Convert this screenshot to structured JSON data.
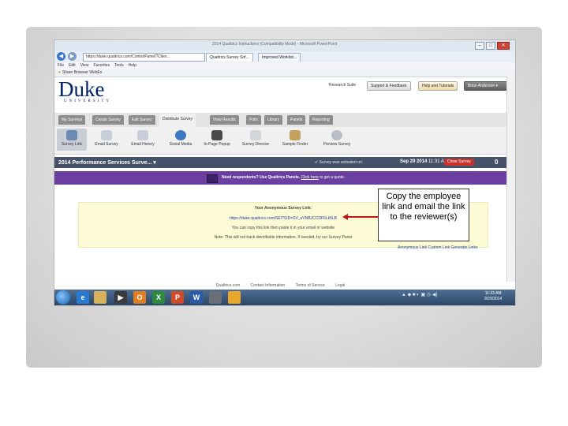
{
  "window": {
    "title": "2014 Qualtrics Instructions (Compatibility Mode) - Microsoft PowerPoint",
    "controls": [
      "–",
      "□",
      "✕"
    ]
  },
  "browser": {
    "address": "https://duke.qualtrics.com/ControlPanel/?Clien...",
    "tabs": [
      "Qualtrics Survey Sof...",
      "Improved Worklist..."
    ],
    "menu": [
      "File",
      "Edit",
      "View",
      "Favorites",
      "Tools",
      "Help"
    ],
    "favorites": "Share Browser  WebEx"
  },
  "header": {
    "logo": "Duke",
    "logo_sub": "UNIVERSITY",
    "research_suite": "Research Suite",
    "support_button": "Support & Feedback",
    "help_button": "Help and Tutorials",
    "user_button": "Brian Anderson"
  },
  "main_tabs": [
    {
      "label": "My Surveys",
      "active": false
    },
    {
      "label": "Create Survey",
      "active": false
    },
    {
      "label": "Edit Survey",
      "active": false
    },
    {
      "label": "Distribute Survey",
      "active": true
    },
    {
      "label": "View Results",
      "active": false
    },
    {
      "label": "Polls",
      "active": false
    },
    {
      "label": "Library",
      "active": false
    },
    {
      "label": "Panels",
      "active": false
    },
    {
      "label": "Reporting",
      "active": false
    }
  ],
  "sub_tabs": [
    {
      "label": "Survey Link",
      "active": true,
      "color": "#6b8bb5"
    },
    {
      "label": "Email Survey",
      "active": false,
      "color": "#c9cfd8"
    },
    {
      "label": "Email History",
      "active": false,
      "color": "#c9cfd8"
    },
    {
      "label": "Social Media",
      "active": false,
      "color": "#3d78c2"
    },
    {
      "label": "In-Page Popup",
      "active": false,
      "color": "#4a4a4a"
    },
    {
      "label": "Survey Director",
      "active": false,
      "color": "#d2d6dc"
    },
    {
      "label": "Sample Finder",
      "active": false,
      "color": "#c4a15c"
    },
    {
      "label": "Preview Survey",
      "active": false,
      "color": "#b9bec6"
    }
  ],
  "survey_bar": {
    "title": "2014 Performance Services Surve...",
    "status": "Survey was activated on:",
    "date": "Sep 29 2014",
    "time": "11:31 AM",
    "close_button": "Close Survey",
    "count": "0"
  },
  "promo": {
    "text": "Need respondents? Use Qualtrics Panels.",
    "link": "Click here",
    "suffix": "to get a quote."
  },
  "link_box": {
    "heading": "Your Anonymous Survey Link:",
    "url": "https://duke.qualtrics.com/SE/?SID=SV_eVNBJCCDF6Lk5LB",
    "copy_note": "You can copy this link then paste it in your email or website",
    "note": "Note: This will not track identifiable information. If needed, try our Survey Panel",
    "extra_links": "Anonymous Link   Custom Link   Generate Links"
  },
  "footer": [
    "Qualtrics.com",
    "Contact Information",
    "Terms of Service",
    "Legal"
  ],
  "taskbar": {
    "clock_time": "11:33 AM",
    "clock_date": "9/29/2014"
  },
  "callout": {
    "text": "Copy the employee link and email the link to the reviewer(s)"
  },
  "colors": {
    "duke_blue": "#012169",
    "survey_bar": "#45526a",
    "promo": "#6a3fa0",
    "arrow": "#c01515"
  }
}
